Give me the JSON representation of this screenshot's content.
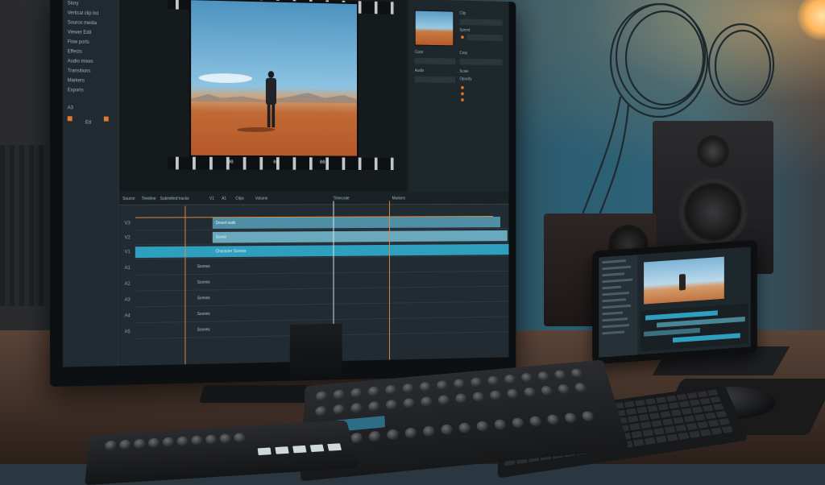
{
  "scene": {
    "description_colors": {
      "accent": "#2f9fbf",
      "clip_orange": "#e0772a",
      "lamp_glow": "#ffb45a",
      "wall_teal": "#2b5e73"
    }
  },
  "editor": {
    "sidebar_items": [
      "Story",
      "Vertical clip list",
      "Source media",
      "Viewer Edit",
      "Flow ports",
      "Effects",
      "Audio mixes",
      "Transitions",
      "Markers",
      "Exports"
    ],
    "sidebar_bottom": [
      "A3",
      "Ed",
      "Ex"
    ],
    "film_strip_labels": [
      "00",
      "00",
      "00"
    ],
    "inspector_labels": [
      "Clip",
      "Speed",
      "Color",
      "Audio",
      "Crop",
      "Scale",
      "Opacity"
    ],
    "timeline_headers": [
      "Source",
      "Timeline",
      "Submitted tracks",
      "V1",
      "A1",
      "Clips",
      "Volume",
      "Timecode",
      "Markers"
    ],
    "tracks": [
      {
        "label": "V3",
        "name": "Scenes",
        "clip": "Desert walk"
      },
      {
        "label": "V2",
        "name": "Scenes",
        "clip": "Scene"
      },
      {
        "label": "V1",
        "name": "Scenes",
        "clip": "Character Scenes"
      },
      {
        "label": "A1",
        "name": "Scenes",
        "clip": ""
      },
      {
        "label": "A2",
        "name": "Scenes",
        "clip": ""
      },
      {
        "label": "A3",
        "name": "Scenes",
        "clip": ""
      },
      {
        "label": "A4",
        "name": "Scenes",
        "clip": ""
      },
      {
        "label": "A5",
        "name": "Scenes",
        "clip": ""
      }
    ]
  },
  "tablet": {
    "panel_lines": 14
  }
}
